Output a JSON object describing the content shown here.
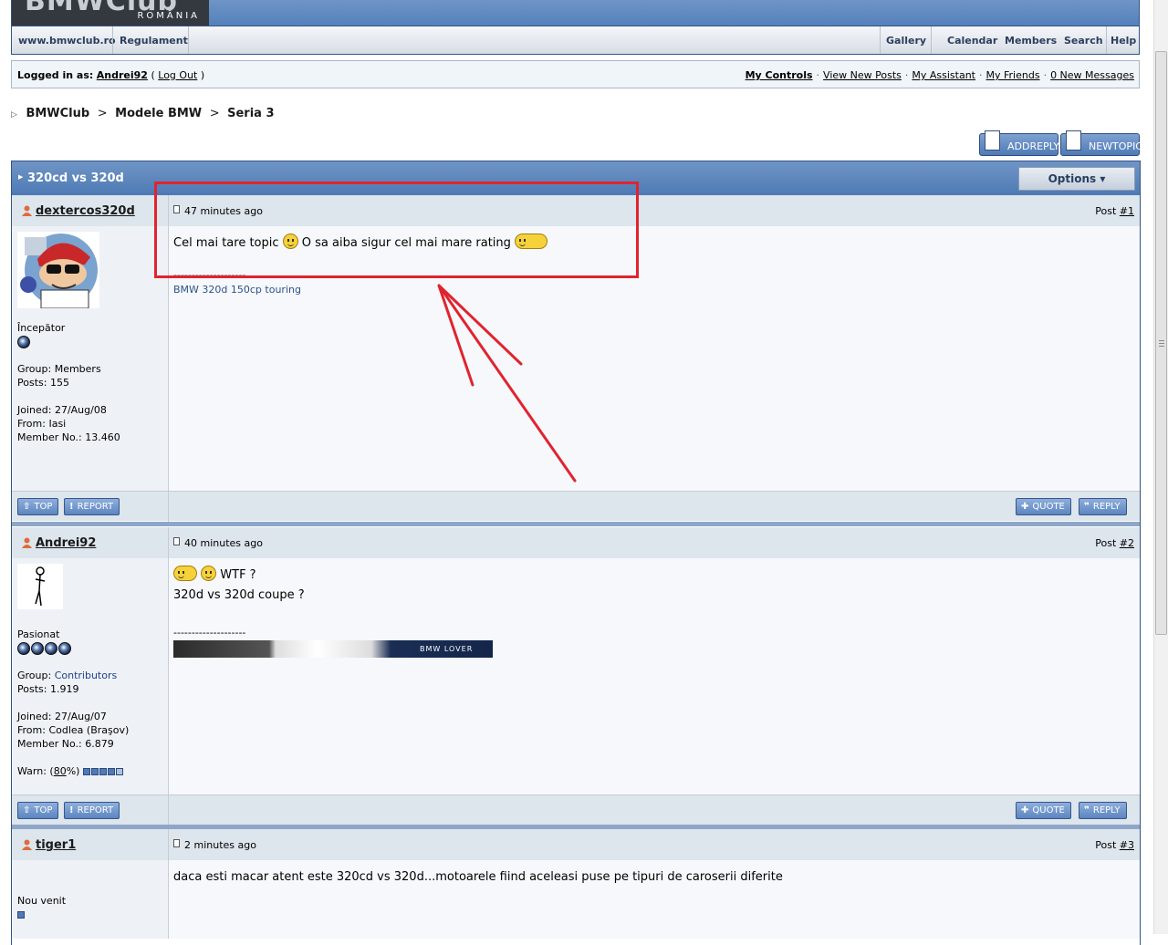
{
  "logo": {
    "big": "BMWClub",
    "small": "ROMÂNIA"
  },
  "nav": {
    "left": [
      "www.bmwclub.ro",
      "Regulament"
    ],
    "right": [
      "Gallery",
      "Calendar",
      "Members",
      "Search",
      "Help"
    ]
  },
  "userbar": {
    "logged_label": "Logged in as:",
    "username": "Andrei92",
    "open_paren": "(",
    "logout": "Log Out",
    "close_paren": ")",
    "links": [
      "My Controls",
      "View New Posts",
      "My Assistant",
      "My Friends",
      "0 New Messages"
    ],
    "separator": "·"
  },
  "breadcrumb": {
    "items": [
      "BMWClub",
      "Modele BMW",
      "Seria 3"
    ],
    "sep": ">"
  },
  "buttons": {
    "add_reply": "ADDREPLY",
    "new_topic": "NEWTOPIC",
    "options": "Options ▾"
  },
  "topic": {
    "title": "320cd vs 320d"
  },
  "posts": [
    {
      "author": "dextercos320d",
      "time": "47 minutes ago",
      "post_label": "Post",
      "post_no": "#1",
      "rank": "Începător",
      "group_label": "Group:",
      "group": "Members",
      "posts_line": "Posts: 155",
      "joined": "Joined: 27/Aug/08",
      "from": "From: Iasi",
      "member_no": "Member No.: 13.460",
      "text_a": "Cel mai tare topic",
      "text_b": "O sa aiba sigur cel mai mare rating",
      "sig_sep": "--------------------",
      "sig": "BMW 320d 150cp touring"
    },
    {
      "author": "Andrei92",
      "time": "40 minutes ago",
      "post_label": "Post",
      "post_no": "#2",
      "rank": "Pasionat",
      "group_label": "Group:",
      "group": "Contributors",
      "posts_line": "Posts: 1.919",
      "joined": "Joined: 27/Aug/07",
      "from": "From: Codlea (Braşov)",
      "member_no": "Member No.: 6.879",
      "warn_label": "Warn: (",
      "warn_val": "80",
      "warn_suffix": "%)",
      "warn_level": 0.8,
      "text_a": "WTF ?",
      "text_b": "320d vs 320d coupe ?",
      "sig_sep": "--------------------",
      "banner_text": "BMW LOVER"
    },
    {
      "author": "tiger1",
      "time": "2 minutes ago",
      "post_label": "Post",
      "post_no": "#3",
      "rank": "Nou venit",
      "text_a": "daca esti macar atent este 320cd vs 320d...motoarele fiind aceleasi puse pe tipuri de caroserii diferite"
    }
  ],
  "post_buttons": {
    "top": "TOP",
    "report": "REPORT",
    "quote": "QUOTE",
    "reply": "REPLY"
  },
  "colors": {
    "header_blue": "#5480bb",
    "annotation_red": "#e0242f",
    "link_blue": "#2c5389"
  }
}
